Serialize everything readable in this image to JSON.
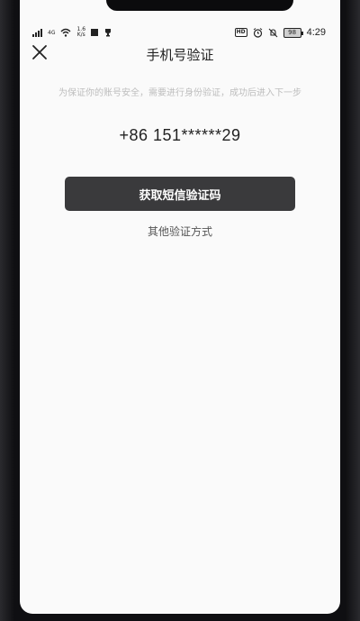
{
  "status_bar": {
    "network_type": "4G",
    "net_speed_value": "1.6",
    "net_speed_unit": "K/s",
    "hd_label": "HD",
    "battery": "98",
    "time": "4:29",
    "icons": [
      "signal-icon",
      "wifi-icon",
      "square-icon",
      "trophy-icon",
      "hd-icon",
      "alarm-icon",
      "mute-icon",
      "battery-icon"
    ]
  },
  "header": {
    "title": "手机号验证",
    "close_icon": "close-icon"
  },
  "content": {
    "hint": "为保证你的账号安全，需要进行身份验证，成功后进入下一步",
    "phone": "+86 151******29",
    "sms_button_label": "获取短信验证码",
    "other_methods_label": "其他验证方式"
  },
  "colors": {
    "button_bg": "#3a3a3c",
    "hint_text": "#bdbdbd",
    "background": "#fafafa"
  }
}
